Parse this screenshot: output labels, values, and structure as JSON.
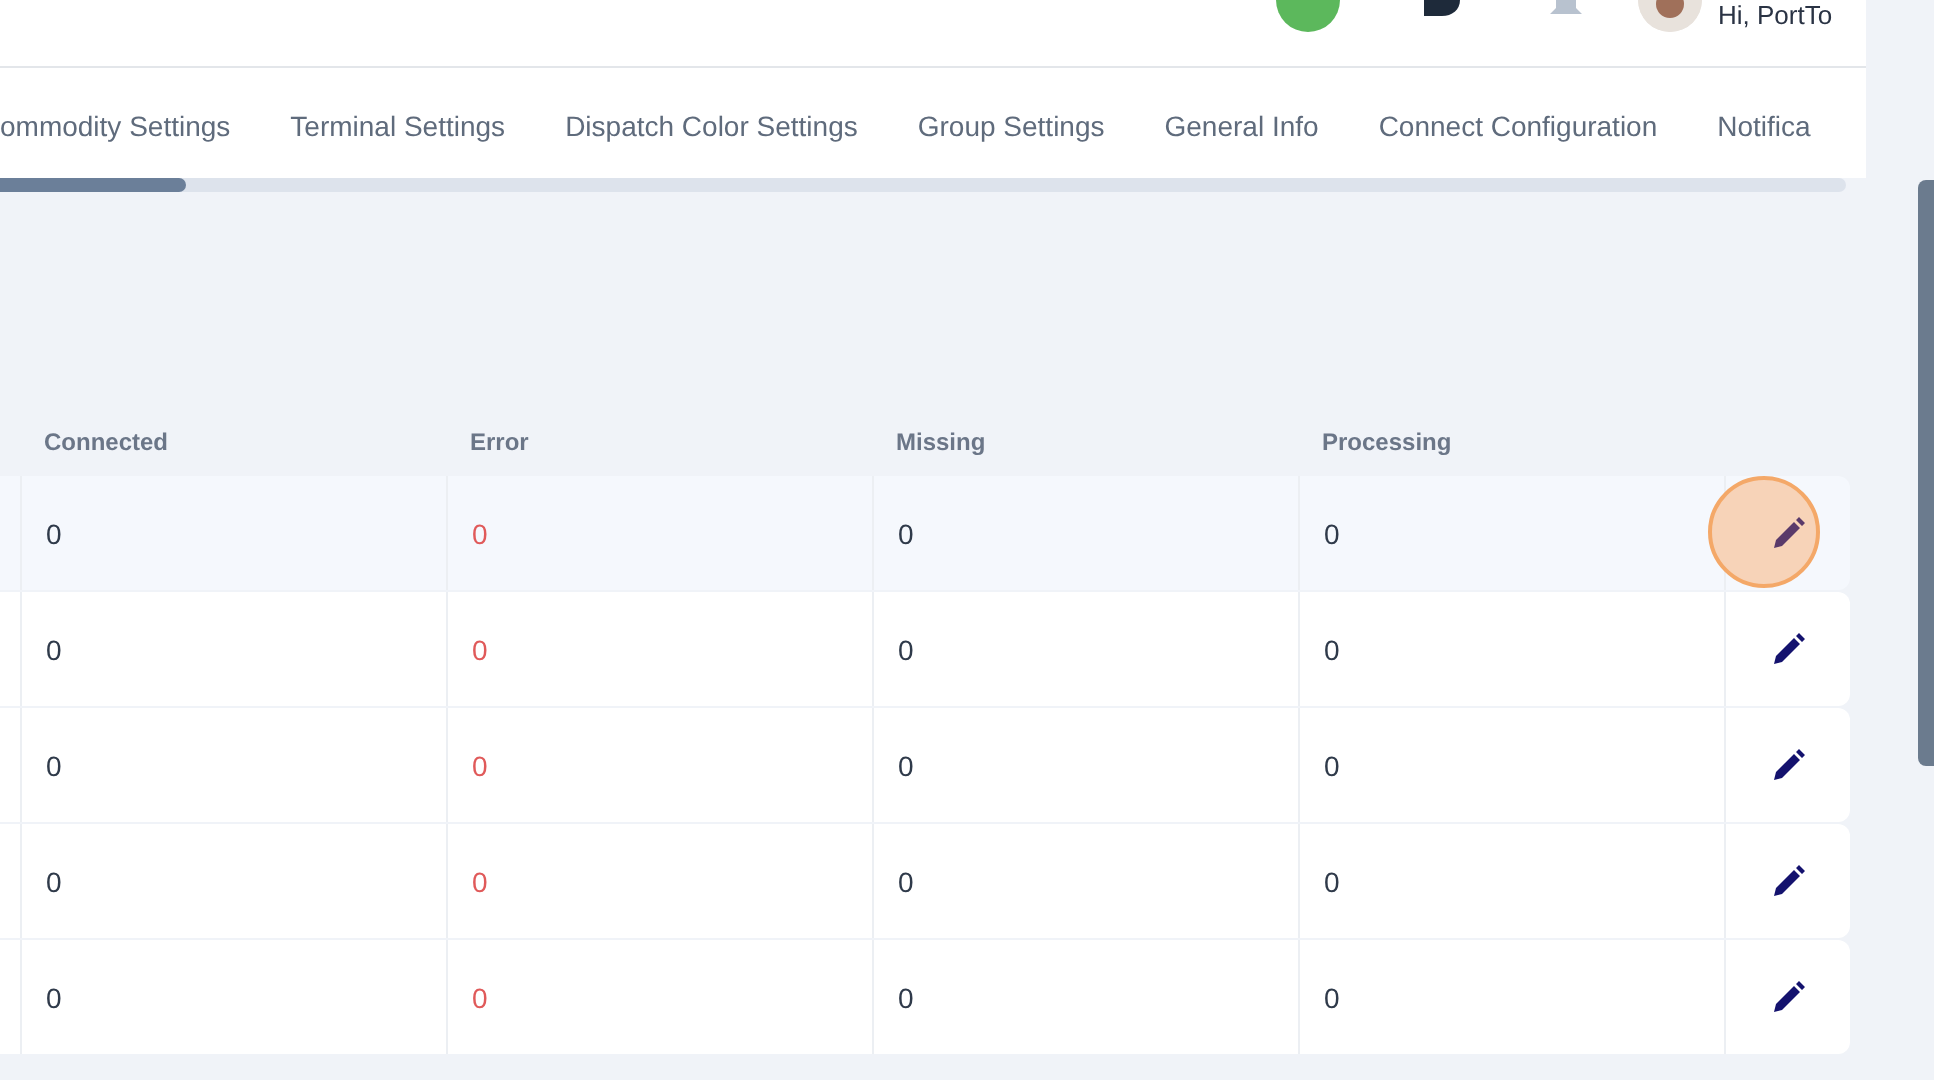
{
  "header": {
    "greeting": "Hi, PortTo"
  },
  "tabs": [
    {
      "label": "ommodity Settings",
      "selected": false
    },
    {
      "label": "Terminal Settings",
      "selected": false
    },
    {
      "label": "Dispatch Color Settings",
      "selected": false
    },
    {
      "label": "Group Settings",
      "selected": false
    },
    {
      "label": "General Info",
      "selected": false
    },
    {
      "label": "Connect Configuration",
      "selected": false
    },
    {
      "label": "Notifica",
      "selected": false
    }
  ],
  "table": {
    "columns": [
      "Connected",
      "Error",
      "Missing",
      "Processing"
    ],
    "rows": [
      {
        "cells": [
          "0",
          "0",
          "0",
          "0"
        ],
        "hovered": true
      },
      {
        "cells": [
          "0",
          "0",
          "0",
          "0"
        ],
        "hovered": false
      },
      {
        "cells": [
          "0",
          "0",
          "0",
          "0"
        ],
        "hovered": false
      },
      {
        "cells": [
          "0",
          "0",
          "0",
          "0"
        ],
        "hovered": false
      },
      {
        "cells": [
          "0",
          "0",
          "0",
          "0"
        ],
        "hovered": false
      }
    ]
  }
}
